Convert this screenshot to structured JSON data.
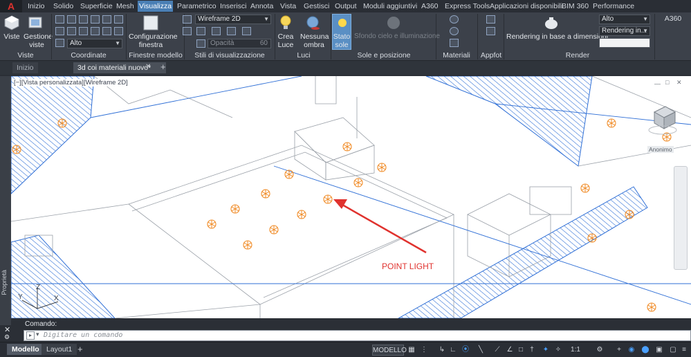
{
  "app": {
    "logo": "A"
  },
  "menu_tabs": [
    "Inizio",
    "Solido",
    "Superficie",
    "Mesh",
    "Visualizza",
    "Parametrico",
    "Inserisci",
    "Annota",
    "Vista",
    "Gestisci",
    "Output",
    "Moduli aggiuntivi",
    "A360",
    "Express Tools",
    "Applicazioni disponibili",
    "BIM 360",
    "Performance"
  ],
  "active_menu_tab": "Visualizza",
  "ribbon": {
    "viste": {
      "btn1": "Viste",
      "btn2_line1": "Gestione",
      "btn2_line2": "viste",
      "panel": "Viste"
    },
    "coordinate": {
      "combo": "Alto",
      "panel": "Coordinate"
    },
    "finestre": {
      "btn_line1": "Configurazione",
      "btn_line2": "finestra",
      "panel": "Finestre modello"
    },
    "stili": {
      "combo": "Wireframe 2D",
      "opacity_label": "Opacità",
      "opacity_value": "60",
      "panel": "Stili di visualizzazione"
    },
    "luci": {
      "btn1_line1": "Crea",
      "btn1_line2": "Luce",
      "btn2_line1": "Nessuna",
      "btn2_line2": "ombra",
      "panel": "Luci"
    },
    "sole": {
      "btn1_line1": "Stato",
      "btn1_line2": "sole",
      "btn2": "Sfondo cielo e illuminazione",
      "panel": "Sole e posizione"
    },
    "materiali": {
      "panel": "Materiali"
    },
    "appfot": {
      "panel": "Appfot"
    },
    "render": {
      "btn": "Rendering in base a dimensioni",
      "combo1": "Alto",
      "combo2": "Rendering in...",
      "panel": "Render"
    },
    "a360": {
      "title": "A360"
    }
  },
  "doc_tabs": [
    "Inizio",
    "3d coi materiali nuovo*"
  ],
  "viewport": {
    "label": "[−][Vista personalizzata][Wireframe 2D]",
    "annotation": "POINT LIGHT",
    "viewcube_label": "Anonimo",
    "side_palette": "Proprietà",
    "axis_labels": {
      "x": "X",
      "y": "Y",
      "z": "Z"
    }
  },
  "command": {
    "history_label": "Comando:",
    "placeholder": "Digitare un comando"
  },
  "status": {
    "layout_tabs": [
      "Modello",
      "Layout1"
    ],
    "model_button": "MODELLO",
    "scale": "1:1"
  },
  "colors": {
    "accent": "#4a7fb5",
    "light_marker": "#f08a24",
    "annotation": "#e0322e",
    "hatch": "#2f6fd6"
  }
}
